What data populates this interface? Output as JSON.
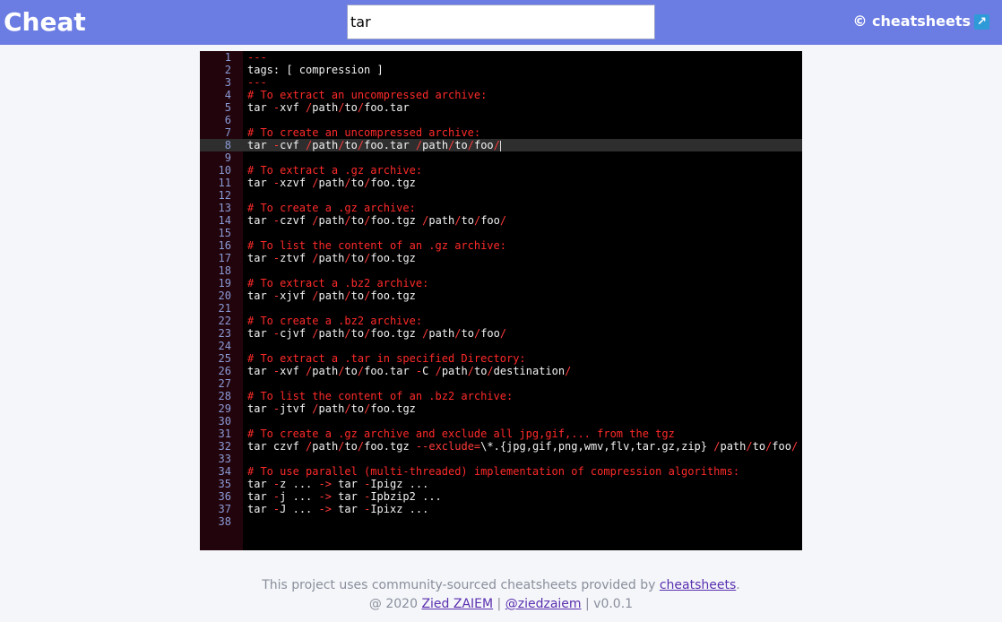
{
  "header": {
    "brand": "Cheat",
    "search_value": "tar",
    "external_link_label": "© cheatsheets",
    "external_icon": "↗"
  },
  "editor": {
    "active_line": 8,
    "lines": [
      {
        "n": "1",
        "t": "---"
      },
      {
        "n": "2",
        "t": "tags: [ compression ]"
      },
      {
        "n": "3",
        "t": "---"
      },
      {
        "n": "4",
        "t": "# To extract an uncompressed archive:"
      },
      {
        "n": "5",
        "t": "tar -xvf /path/to/foo.tar"
      },
      {
        "n": "6",
        "t": ""
      },
      {
        "n": "7",
        "t": "# To create an uncompressed archive:"
      },
      {
        "n": "8",
        "t": "tar -cvf /path/to/foo.tar /path/to/foo/"
      },
      {
        "n": "9",
        "t": ""
      },
      {
        "n": "10",
        "t": "# To extract a .gz archive:"
      },
      {
        "n": "11",
        "t": "tar -xzvf /path/to/foo.tgz"
      },
      {
        "n": "12",
        "t": ""
      },
      {
        "n": "13",
        "t": "# To create a .gz archive:"
      },
      {
        "n": "14",
        "t": "tar -czvf /path/to/foo.tgz /path/to/foo/"
      },
      {
        "n": "15",
        "t": ""
      },
      {
        "n": "16",
        "t": "# To list the content of an .gz archive:"
      },
      {
        "n": "17",
        "t": "tar -ztvf /path/to/foo.tgz"
      },
      {
        "n": "18",
        "t": ""
      },
      {
        "n": "19",
        "t": "# To extract a .bz2 archive:"
      },
      {
        "n": "20",
        "t": "tar -xjvf /path/to/foo.tgz"
      },
      {
        "n": "21",
        "t": ""
      },
      {
        "n": "22",
        "t": "# To create a .bz2 archive:"
      },
      {
        "n": "23",
        "t": "tar -cjvf /path/to/foo.tgz /path/to/foo/"
      },
      {
        "n": "24",
        "t": ""
      },
      {
        "n": "25",
        "t": "# To extract a .tar in specified Directory:"
      },
      {
        "n": "26",
        "t": "tar -xvf /path/to/foo.tar -C /path/to/destination/"
      },
      {
        "n": "27",
        "t": ""
      },
      {
        "n": "28",
        "t": "# To list the content of an .bz2 archive:"
      },
      {
        "n": "29",
        "t": "tar -jtvf /path/to/foo.tgz"
      },
      {
        "n": "30",
        "t": ""
      },
      {
        "n": "31",
        "t": "# To create a .gz archive and exclude all jpg,gif,... from the tgz"
      },
      {
        "n": "32",
        "t": "tar czvf /path/to/foo.tgz --exclude=\\*.{jpg,gif,png,wmv,flv,tar.gz,zip} /path/to/foo/"
      },
      {
        "n": "33",
        "t": ""
      },
      {
        "n": "34",
        "t": "# To use parallel (multi-threaded) implementation of compression algorithms:"
      },
      {
        "n": "35",
        "t": "tar -z ... -> tar -Ipigz ..."
      },
      {
        "n": "36",
        "t": "tar -j ... -> tar -Ipbzip2 ..."
      },
      {
        "n": "37",
        "t": "tar -J ... -> tar -Ipixz ..."
      },
      {
        "n": "38",
        "t": ""
      }
    ]
  },
  "footer": {
    "line1_text": "This project uses community-sourced cheatsheets provided by ",
    "line1_link": "cheatsheets",
    "line1_end": ".",
    "line2_prefix": "@ 2020 ",
    "author_link": "Zied ZAIEM",
    "separator": " | ",
    "handle_link": "@ziedzaiem",
    "version": " | v0.0.1"
  },
  "colors": {
    "header_bg": "#6b7ce3",
    "comment": "#ff2a2a",
    "gutter_bg": "#22040c",
    "line_number": "#8a9bd6"
  }
}
